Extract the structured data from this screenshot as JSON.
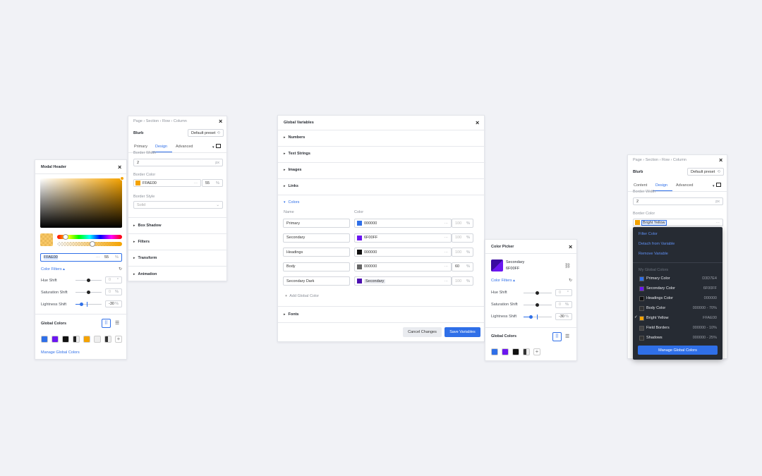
{
  "modal": {
    "title": "Modal Header",
    "hex": "FFAE00",
    "opacity": "55",
    "unit": "%",
    "filters_label": "Color Filters",
    "hue_label": "Hue Shift",
    "hue_value": "0",
    "hue_unit": "°",
    "sat_label": "Saturation Shift",
    "sat_value": "0",
    "sat_unit": "%",
    "light_label": "Lightness Shift",
    "light_value": "-30",
    "light_unit": "%",
    "global_label": "Global Colors",
    "manage": "Manage Global Colors",
    "swatches": [
      "#2f6fe8",
      "#6b16f0",
      "#111111",
      "#222222",
      "#f5a300",
      "#eeeeee",
      "#333333"
    ]
  },
  "blurb": {
    "breadcrumb": [
      "Page",
      "Section",
      "Row",
      "Column"
    ],
    "title": "Blurb",
    "preset": "Default preset",
    "tabs": [
      "Primary",
      "Design",
      "Advanced"
    ],
    "active_tab": "Design",
    "border_width_label": "Border Width",
    "border_width": "2",
    "px": "px",
    "border_color_label": "Border Color",
    "border_color": "FFAE00",
    "border_opacity": "55",
    "pct": "%",
    "border_style_label": "Border Style",
    "border_style": "Solid",
    "sections": [
      "Box Shadow",
      "Filters",
      "Transform",
      "Animation"
    ]
  },
  "global_vars": {
    "title": "Global Variables",
    "sections": [
      "Numbers",
      "Text Strings",
      "Images",
      "Links"
    ],
    "colors_label": "Colors",
    "col_name": "Name",
    "col_color": "Color",
    "rows": [
      {
        "name": "Primary",
        "hex": "000000",
        "opacity": "100",
        "color": "#2f6fe8"
      },
      {
        "name": "Secondary",
        "hex": "6F00FF",
        "opacity": "100",
        "color": "#6b16f0"
      },
      {
        "name": "Headings",
        "hex": "000000",
        "opacity": "100",
        "color": "#111111"
      },
      {
        "name": "Body",
        "hex": "000000",
        "opacity": "60",
        "color": "#666666"
      },
      {
        "name": "Secondary Dark",
        "hex": "Secondary",
        "opacity": "100",
        "color": "#4b0fb0"
      }
    ],
    "pct": "%",
    "add": "Add Global Color",
    "fonts": "Fonts",
    "cancel": "Cancel Changes",
    "save": "Save Variables"
  },
  "picker": {
    "title": "Color Picker",
    "name": "Secondary",
    "hex": "6F00FF",
    "filters_label": "Color Filters",
    "hue_label": "Hue Shift",
    "hue_value": "0",
    "hue_unit": "°",
    "sat_label": "Saturation Shift",
    "sat_value": "0",
    "sat_unit": "%",
    "light_label": "Lightness Shift",
    "light_value": "-30",
    "light_unit": "%",
    "global_label": "Global Colors",
    "swatches": [
      "#2f6fe8",
      "#6b16f0",
      "#111111",
      "#333333"
    ]
  },
  "right": {
    "breadcrumb": [
      "Page",
      "Section",
      "Row",
      "Column"
    ],
    "title": "Blurb",
    "preset": "Default preset",
    "tabs": [
      "Content",
      "Design",
      "Advanced"
    ],
    "active_tab": "Design",
    "border_width_label": "Border Width",
    "border_width": "2",
    "px": "px",
    "border_color_label": "Border Color",
    "border_color": "Bright Yellow",
    "menu": [
      "Filter Color",
      "Detach from Variable",
      "Remove Variable"
    ],
    "my_colors_label": "My Global Colors",
    "colors": [
      {
        "name": "Primary Color",
        "value": "D3D7E4",
        "color": "#2f6fe8"
      },
      {
        "name": "Secondary Color",
        "value": "6F00FF",
        "color": "#6b16f0"
      },
      {
        "name": "Headings Color",
        "value": "000000",
        "color": "#111111"
      },
      {
        "name": "Body Color",
        "value": "000000 - 70%",
        "color": "#333333"
      },
      {
        "name": "Bright Yellow",
        "value": "FFAE00",
        "color": "#f5a300"
      },
      {
        "name": "Field Borders",
        "value": "000000 - 10%",
        "color": "#444444"
      },
      {
        "name": "Shadows",
        "value": "000000 - 25%",
        "color": "#333333"
      }
    ],
    "selected": "Bright Yellow",
    "manage": "Manage Global Colors"
  }
}
